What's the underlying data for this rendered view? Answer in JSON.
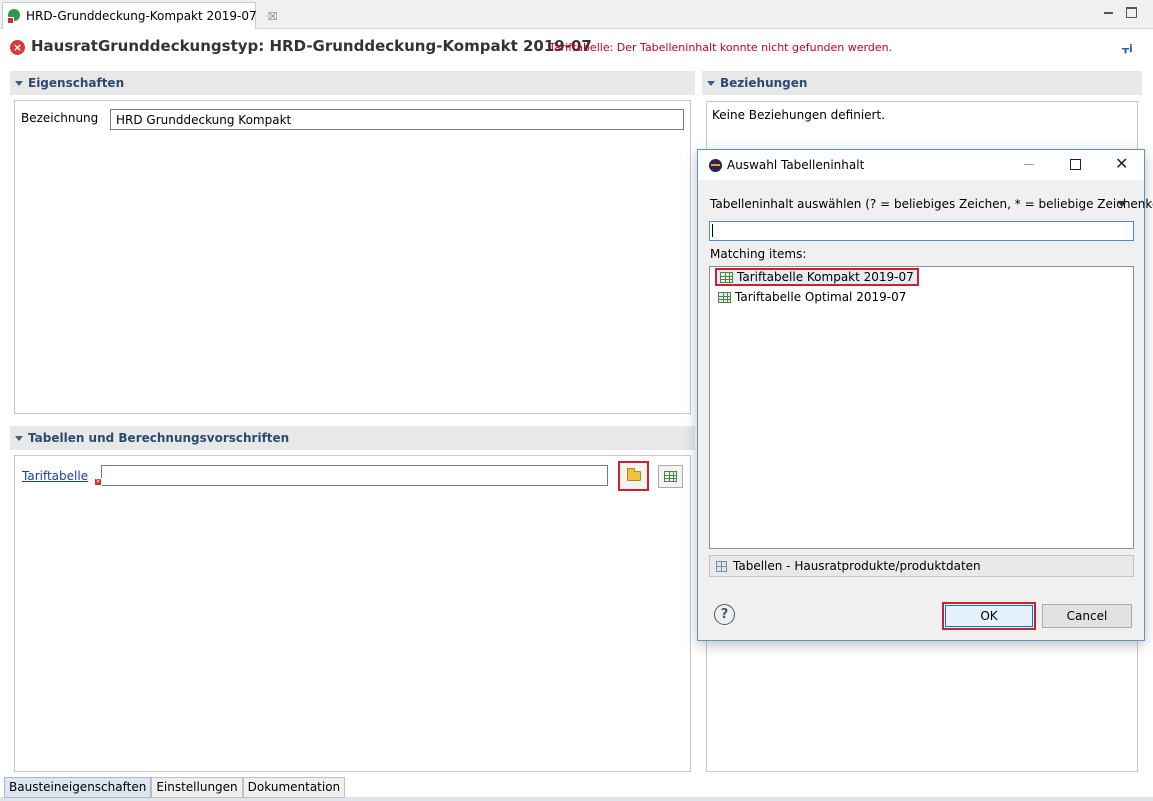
{
  "editor": {
    "tab_label": "HRD-Grunddeckung-Kompakt 2019-07",
    "tab_close": "☒",
    "title": "HausratGrunddeckungstyp: HRD-Grunddeckung-Kompakt 2019-07",
    "error_message": "Tariftabelle: Der Tabelleninhalt  konnte nicht gefunden werden."
  },
  "sections": {
    "eigenschaften": {
      "title": "Eigenschaften",
      "bezeichnung_label": "Bezeichnung",
      "bezeichnung_value": "HRD Grunddeckung Kompakt"
    },
    "tabellen": {
      "title": "Tabellen und Berechnungsvorschriften",
      "tariftabelle_label": "Tariftabelle",
      "tariftabelle_value": ""
    },
    "beziehungen": {
      "title": "Beziehungen",
      "empty_text": "Keine Beziehungen definiert."
    }
  },
  "bottom_tabs": [
    "Bausteineigenschaften",
    "Einstellungen",
    "Dokumentation"
  ],
  "dialog": {
    "title": "Auswahl Tabelleninhalt",
    "filter_label": "Tabelleninhalt auswählen (? = beliebiges Zeichen, * = beliebige Zeichenkett",
    "search_value": "",
    "matching_label": "Matching items:",
    "items": [
      "Tariftabelle Kompakt 2019-07",
      "Tariftabelle Optimal 2019-07"
    ],
    "selected_index": 0,
    "source": "Tabellen - Hausratprodukte/produktdaten",
    "ok_label": "OK",
    "cancel_label": "Cancel"
  },
  "colors": {
    "error": "#c8001e",
    "section_title": "#2b4a73",
    "link": "#1a3dab",
    "highlight": "#d0202a"
  }
}
